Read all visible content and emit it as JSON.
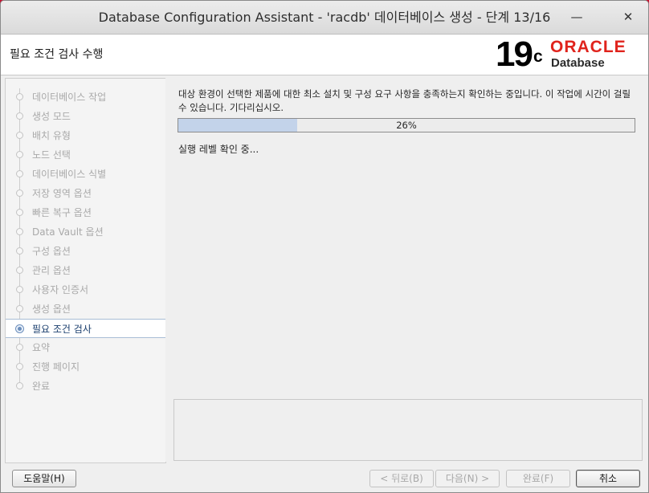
{
  "window": {
    "title": "Database Configuration Assistant - 'racdb' 데이터베이스 생성 - 단계 13/16",
    "minimize_glyph": "—",
    "close_glyph": "✕"
  },
  "header": {
    "page_title": "필요 조건 검사 수행",
    "logo_version": "19",
    "logo_version_sup": "c",
    "logo_brand": "ORACLE",
    "logo_product": "Database"
  },
  "sidebar": {
    "steps": [
      {
        "label": "데이터베이스 작업",
        "state": "done"
      },
      {
        "label": "생성 모드",
        "state": "done"
      },
      {
        "label": "배치 유형",
        "state": "done"
      },
      {
        "label": "노드 선택",
        "state": "done"
      },
      {
        "label": "데이터베이스 식별",
        "state": "done"
      },
      {
        "label": "저장 영역 옵션",
        "state": "done"
      },
      {
        "label": "빠른 복구 옵션",
        "state": "done"
      },
      {
        "label": "Data Vault 옵션",
        "state": "done"
      },
      {
        "label": "구성 옵션",
        "state": "done"
      },
      {
        "label": "관리 옵션",
        "state": "done"
      },
      {
        "label": "사용자 인증서",
        "state": "done"
      },
      {
        "label": "생성 옵션",
        "state": "done"
      },
      {
        "label": "필요 조건 검사",
        "state": "active"
      },
      {
        "label": "요약",
        "state": "pending"
      },
      {
        "label": "진행 페이지",
        "state": "pending"
      },
      {
        "label": "완료",
        "state": "pending"
      }
    ]
  },
  "content": {
    "description": "대상 환경이 선택한 제품에 대한 최소 설치 및 구성 요구 사항을 충족하는지 확인하는 중입니다. 이 작업에 시간이 걸릴 수 있습니다. 기다리십시오.",
    "progress_percent": 26,
    "progress_label": "26%",
    "status_text": "실행 레벨 확인 중..."
  },
  "footer": {
    "help_label": "도움말(H)",
    "back_label": "< 뒤로(B)",
    "next_label": "다음(N) >",
    "finish_label": "완료(F)",
    "cancel_label": "취소"
  }
}
